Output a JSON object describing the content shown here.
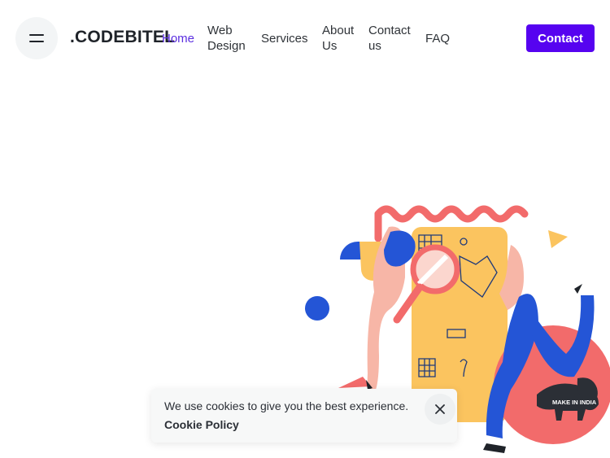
{
  "header": {
    "logo": ".CODEBITEL",
    "menu_icon": "hamburger-menu-icon",
    "nav": [
      {
        "label": "Home",
        "active": true
      },
      {
        "label": "Web Design",
        "active": false
      },
      {
        "label": "Services",
        "active": false
      },
      {
        "label": "About Us",
        "active": false
      },
      {
        "label": "Contact us",
        "active": false
      },
      {
        "label": "FAQ",
        "active": false
      }
    ],
    "contact_button": "Contact",
    "accent_color": "#5603f0"
  },
  "hero": {
    "illustration": "person-with-magnifying-glass-illustration",
    "badge": "MAKE IN INDIA"
  },
  "cookie_banner": {
    "message": "We use cookies to give you the best experience.",
    "policy_link": "Cookie Policy",
    "close_icon": "close-icon"
  }
}
